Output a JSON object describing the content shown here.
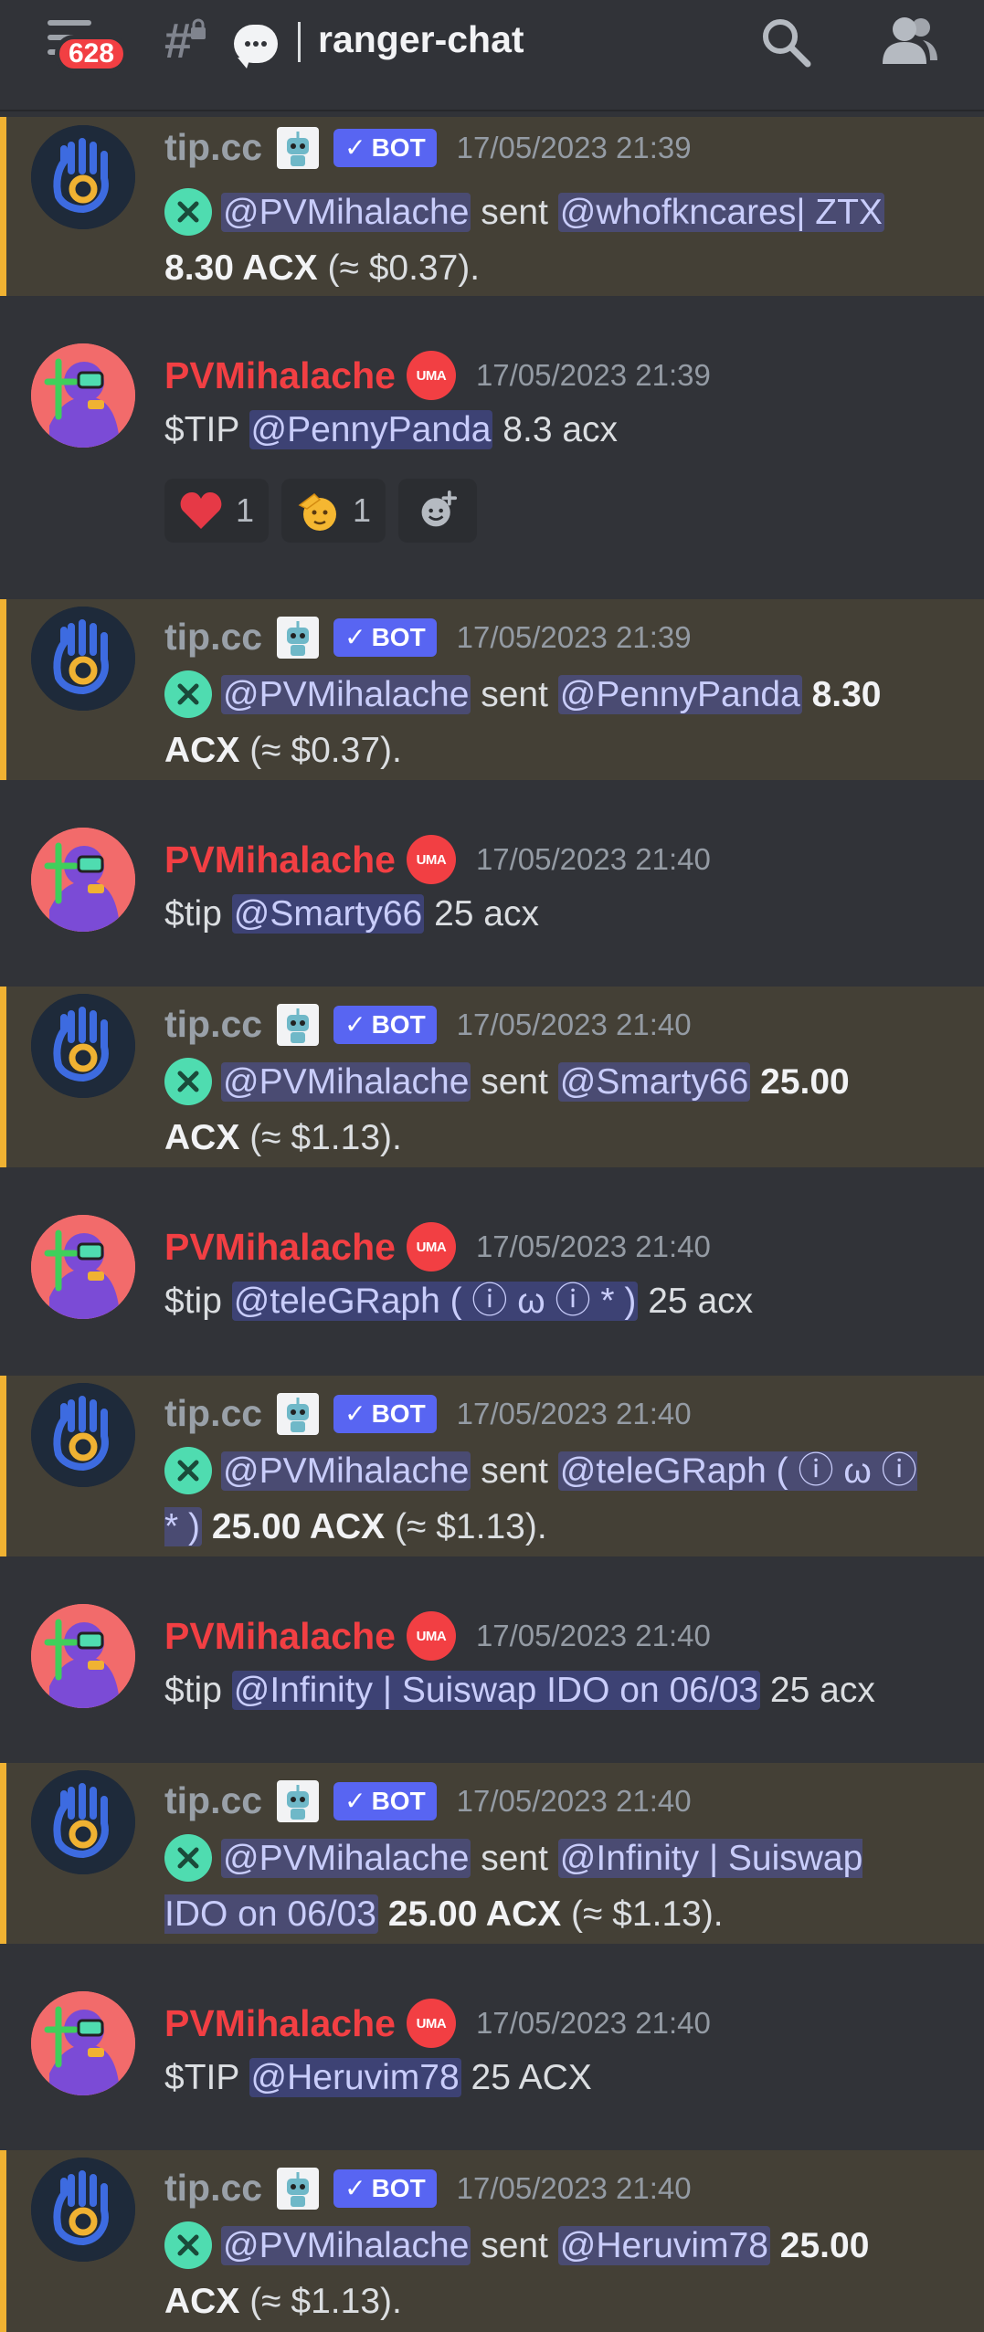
{
  "header": {
    "notification_count": "628",
    "channel_name": "ranger-chat"
  },
  "colors": {
    "background": "#313338",
    "bot_highlight": "#444036",
    "highlight_bar": "#f0b232",
    "mention_bg": "#5865f2",
    "pv_name": "#f23f43",
    "bot_name": "#99a0a8"
  },
  "messages": [
    {
      "author": "tip.cc",
      "bot_tag": "BOT",
      "time": "17/05/2023 21:39",
      "sender": "@PVMihalache",
      "sent": "sent",
      "recipient": "@whofkncares| ZTX",
      "amount": "8.30 ACX",
      "usd": "(≈ $0.37)."
    },
    {
      "author": "PVMihalache",
      "badge": "UMA",
      "time": "17/05/2023 21:39",
      "command": "$TIP",
      "mention": "@PennyPanda",
      "rest": "8.3 acx",
      "reactions": [
        {
          "emoji": "heart-emoji",
          "count": "1"
        },
        {
          "emoji": "saluting-face-emoji",
          "count": "1"
        }
      ]
    },
    {
      "author": "tip.cc",
      "bot_tag": "BOT",
      "time": "17/05/2023 21:39",
      "sender": "@PVMihalache",
      "sent": "sent",
      "recipient": "@PennyPanda",
      "amount": "8.30 ACX",
      "usd": "(≈ $0.37)."
    },
    {
      "author": "PVMihalache",
      "badge": "UMA",
      "time": "17/05/2023 21:40",
      "command": "$tip",
      "mention": "@Smarty66",
      "rest": "25 acx"
    },
    {
      "author": "tip.cc",
      "bot_tag": "BOT",
      "time": "17/05/2023 21:40",
      "sender": "@PVMihalache",
      "sent": "sent",
      "recipient": "@Smarty66",
      "amount": "25.00 ACX",
      "usd": "(≈ $1.13)."
    },
    {
      "author": "PVMihalache",
      "badge": "UMA",
      "time": "17/05/2023 21:40",
      "command": "$tip",
      "mention": "@teleGRaph ( ⓘ ω ⓘ * )",
      "rest": "25 acx"
    },
    {
      "author": "tip.cc",
      "bot_tag": "BOT",
      "time": "17/05/2023 21:40",
      "sender": "@PVMihalache",
      "sent": "sent",
      "recipient": "@teleGRaph ( ⓘ ω ⓘ * )",
      "amount": "25.00 ACX",
      "usd": "(≈ $1.13)."
    },
    {
      "author": "PVMihalache",
      "badge": "UMA",
      "time": "17/05/2023 21:40",
      "command": "$tip",
      "mention": "@Infinity | Suiswap IDO on 06/03",
      "rest": "25 acx"
    },
    {
      "author": "tip.cc",
      "bot_tag": "BOT",
      "time": "17/05/2023 21:40",
      "sender": "@PVMihalache",
      "sent": "sent",
      "recipient": "@Infinity | Suiswap IDO on 06/03",
      "amount": "25.00 ACX",
      "usd": "(≈ $1.13)."
    },
    {
      "author": "PVMihalache",
      "badge": "UMA",
      "time": "17/05/2023 21:40",
      "command": "$TIP",
      "mention": "@Heruvim78",
      "rest": "25 ACX"
    },
    {
      "author": "tip.cc",
      "bot_tag": "BOT",
      "time": "17/05/2023 21:40",
      "sender": "@PVMihalache",
      "sent": "sent",
      "recipient": "@Heruvim78",
      "amount": "25.00 ACX",
      "usd": "(≈ $1.13)."
    }
  ]
}
